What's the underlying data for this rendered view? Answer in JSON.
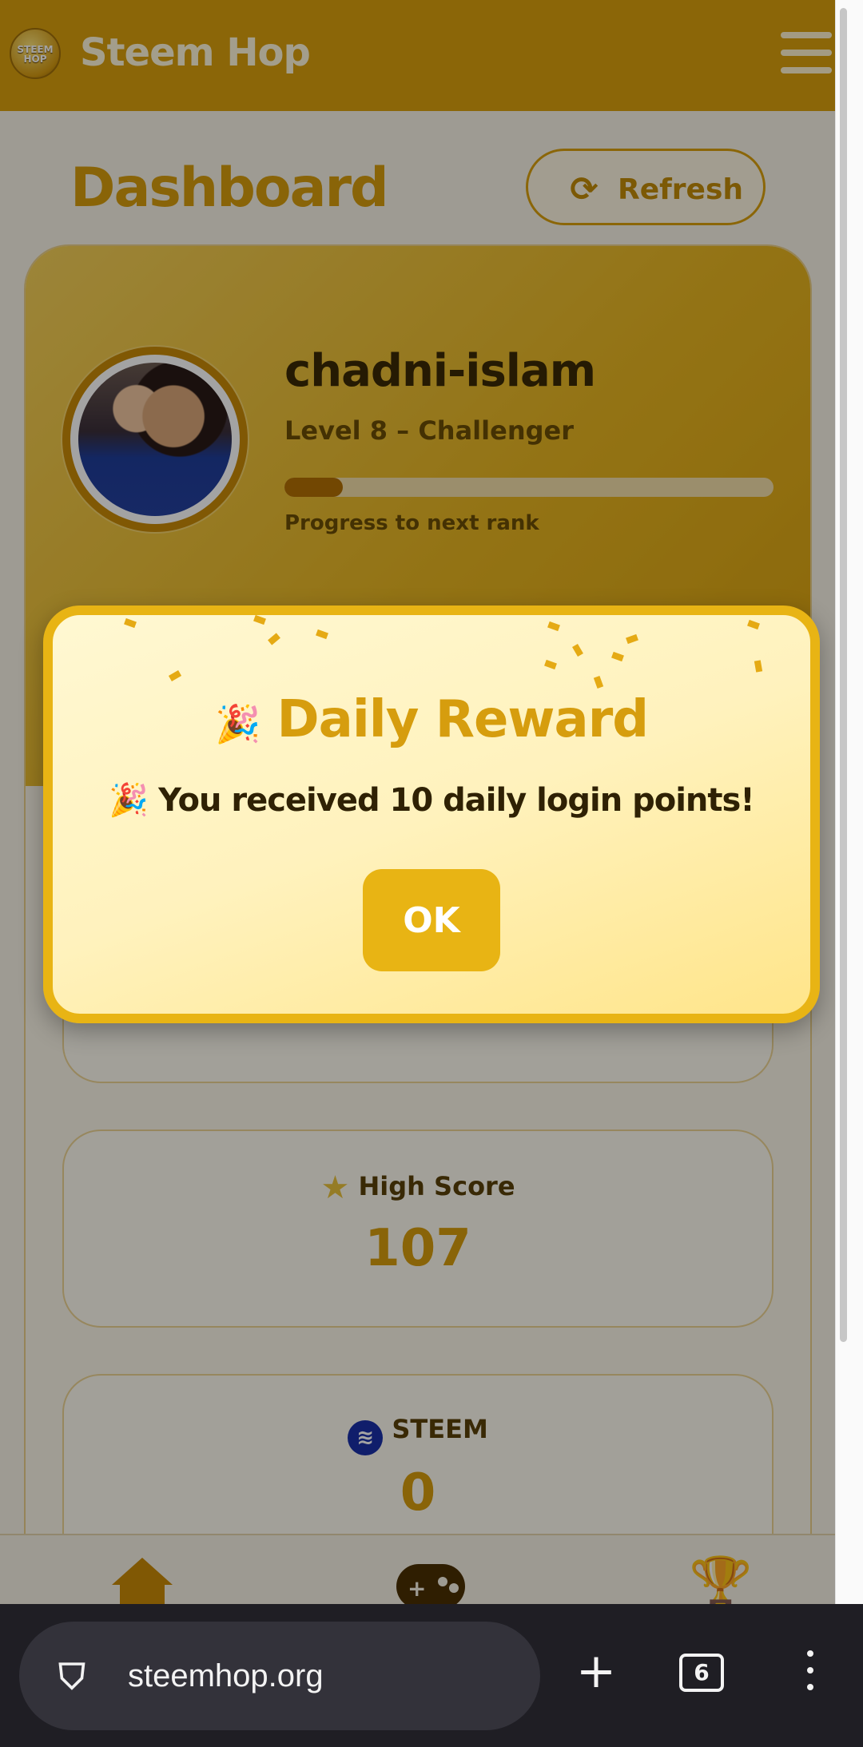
{
  "app": {
    "title": "Steem Hop",
    "logo_text": "STEEM HOP"
  },
  "dashboard": {
    "title": "Dashboard",
    "refresh_label": "Refresh"
  },
  "profile": {
    "username": "chadni-islam",
    "level": "Level 8 – Challenger",
    "progress_label": "Progress to next rank",
    "progress_fraction": 0.12
  },
  "stats": {
    "high_score": {
      "label": "High Score",
      "value": "107"
    },
    "steem": {
      "label": "STEEM",
      "value": "0"
    }
  },
  "modal": {
    "title": "Daily Reward",
    "title_emoji": "🎉",
    "message": "You received 10 daily login points!",
    "message_emoji": "🎉",
    "ok_label": "OK"
  },
  "browser": {
    "url": "steemhop.org",
    "tab_count": "6"
  },
  "icons": {
    "refresh": "refresh-icon",
    "star": "star-icon",
    "steem": "steem-icon",
    "home": "home-icon",
    "gamepad": "gamepad-icon",
    "trophy": "trophy-icon",
    "shield": "shield-icon",
    "plus": "plus-icon",
    "more": "more-vertical-icon"
  },
  "colors": {
    "brand": "#d9a00d",
    "accent": "#e8b414",
    "modal_bg": "#fff2bd",
    "browser_bar": "#1f1e24"
  }
}
